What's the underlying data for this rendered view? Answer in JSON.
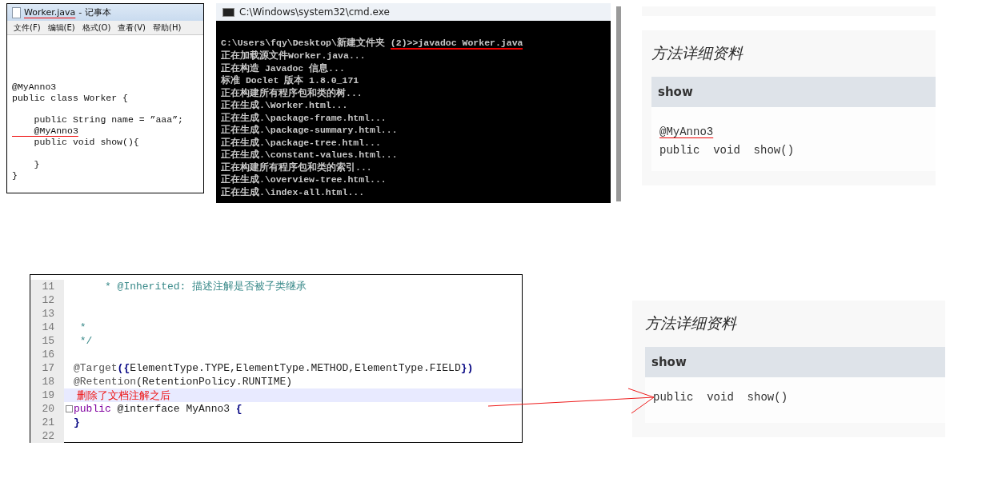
{
  "notepad": {
    "title_file": "Worker.java",
    "title_app": "- 记事本",
    "title_underlined": true,
    "menu": [
      "文件(F)",
      "编辑(E)",
      "格式(O)",
      "查看(V)",
      "帮助(H)"
    ],
    "code_blocks": [
      [
        {
          "text": "@MyAnno3",
          "underlined": false
        },
        {
          "text": "public class Worker {",
          "underlined": false
        }
      ],
      [
        {
          "text": "    public String name = ”aaa”;",
          "underlined": false
        },
        {
          "text": "    @MyAnno3",
          "underlined": true
        },
        {
          "text": "    public void show(){",
          "underlined": false
        }
      ],
      [
        {
          "text": "    }",
          "underlined": false
        },
        {
          "text": "}",
          "underlined": false
        }
      ]
    ]
  },
  "console": {
    "title": "C:\\Windows\\system32\\cmd.exe",
    "prompt": "C:\\Users\\fqy\\Desktop\\新建文件夹 ",
    "command": "(2)>>javadoc Worker.java",
    "command_underlined": true,
    "lines": [
      "正在加载源文件Worker.java...",
      "正在构造 Javadoc 信息...",
      "标准 Doclet 版本 1.8.0_171",
      "正在构建所有程序包和类的树...",
      "正在生成.\\Worker.html...",
      "正在生成.\\package-frame.html...",
      "正在生成.\\package-summary.html...",
      "正在生成.\\package-tree.html...",
      "正在生成.\\constant-values.html...",
      "正在构建所有程序包和类的索引...",
      "正在生成.\\overview-tree.html...",
      "正在生成.\\index-all.html..."
    ]
  },
  "javadoc_before": {
    "heading": "方法详细资料",
    "method": "show",
    "annotation": "@MyAnno3",
    "annotation_underlined": true,
    "signature": "public  void  show()"
  },
  "editor": {
    "lines": [
      {
        "number": "11",
        "highlighted": false,
        "fold": false,
        "segments": [
          {
            "kind": "comment",
            "text": "     * @Inherited: 描述注解是否被子类继承"
          }
        ]
      },
      {
        "number": "12",
        "highlighted": false,
        "fold": false
      },
      {
        "number": "13",
        "highlighted": false,
        "fold": false
      },
      {
        "number": "14",
        "highlighted": false,
        "fold": false,
        "segments": [
          {
            "kind": "comment",
            "text": " *"
          }
        ]
      },
      {
        "number": "15",
        "highlighted": false,
        "fold": false,
        "segments": [
          {
            "kind": "comment",
            "text": " */"
          }
        ]
      },
      {
        "number": "16",
        "highlighted": false,
        "fold": false
      },
      {
        "number": "17",
        "highlighted": false,
        "fold": false,
        "segments": [
          {
            "kind": "annotation",
            "text": "@Target"
          },
          {
            "kind": "brace",
            "text": "({"
          },
          {
            "kind": "plain",
            "text": "ElementType.TYPE,ElementType.METHOD,ElementType.FIELD"
          },
          {
            "kind": "brace",
            "text": "})"
          }
        ]
      },
      {
        "number": "18",
        "highlighted": false,
        "fold": false,
        "segments": [
          {
            "kind": "annotation",
            "text": "@Retention"
          },
          {
            "kind": "plain",
            "text": "(RetentionPolicy.RUNTIME)"
          }
        ]
      },
      {
        "number": "19",
        "highlighted": true,
        "fold": false,
        "segments": [
          {
            "kind": "note",
            "text": " 删除了文档注解之后"
          }
        ]
      },
      {
        "number": "20",
        "highlighted": false,
        "fold": true,
        "segments": [
          {
            "kind": "keyword",
            "text": "public"
          },
          {
            "kind": "plain",
            "text": " @interface MyAnno3 "
          },
          {
            "kind": "brace",
            "text": "{"
          }
        ]
      },
      {
        "number": "21",
        "highlighted": false,
        "fold": false,
        "segments": [
          {
            "kind": "brace",
            "text": "}"
          }
        ]
      },
      {
        "number": "22",
        "highlighted": false,
        "fold": false
      }
    ]
  },
  "javadoc_after": {
    "heading": "方法详细资料",
    "method": "show",
    "signature": "public  void  show()"
  }
}
